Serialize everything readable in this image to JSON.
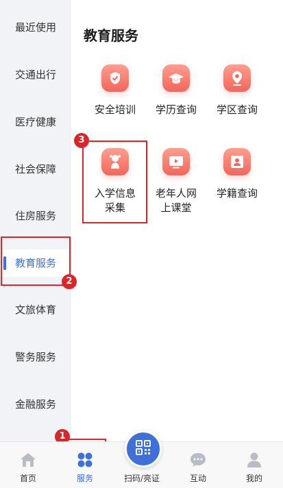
{
  "sidebar": {
    "items": [
      {
        "label": "最近使用"
      },
      {
        "label": "交通出行"
      },
      {
        "label": "医疗健康"
      },
      {
        "label": "社会保障"
      },
      {
        "label": "住房服务"
      },
      {
        "label": "教育服务",
        "active": true
      },
      {
        "label": "文旅体育"
      },
      {
        "label": "警务服务"
      },
      {
        "label": "金融服务"
      }
    ]
  },
  "main": {
    "title": "教育服务",
    "tiles": [
      {
        "label": "安全培训",
        "icon": "shield-check-icon"
      },
      {
        "label": "学历查询",
        "icon": "graduation-cap-icon"
      },
      {
        "label": "学区查询",
        "icon": "location-pin-icon"
      },
      {
        "label": "入学信息\n采集",
        "icon": "child-icon"
      },
      {
        "label": "老年人网\n上课堂",
        "icon": "video-play-icon"
      },
      {
        "label": "学籍查询",
        "icon": "student-card-icon"
      }
    ]
  },
  "annotations": {
    "badge1": "1",
    "badge2": "2",
    "badge3": "3"
  },
  "bottom_nav": {
    "items": [
      {
        "label": "首页",
        "icon": "home-icon"
      },
      {
        "label": "服务",
        "icon": "grid-icon",
        "active": true
      },
      {
        "label": "扫码/亮证",
        "icon": "qr-code-icon"
      },
      {
        "label": "互动",
        "icon": "chat-icon"
      },
      {
        "label": "我的",
        "icon": "user-icon"
      }
    ]
  },
  "colors": {
    "accent": "#3f6fd8",
    "tile_gradient_top": "#ff9e8f",
    "tile_gradient_bottom": "#f2665a",
    "annotation": "#d8262b"
  }
}
